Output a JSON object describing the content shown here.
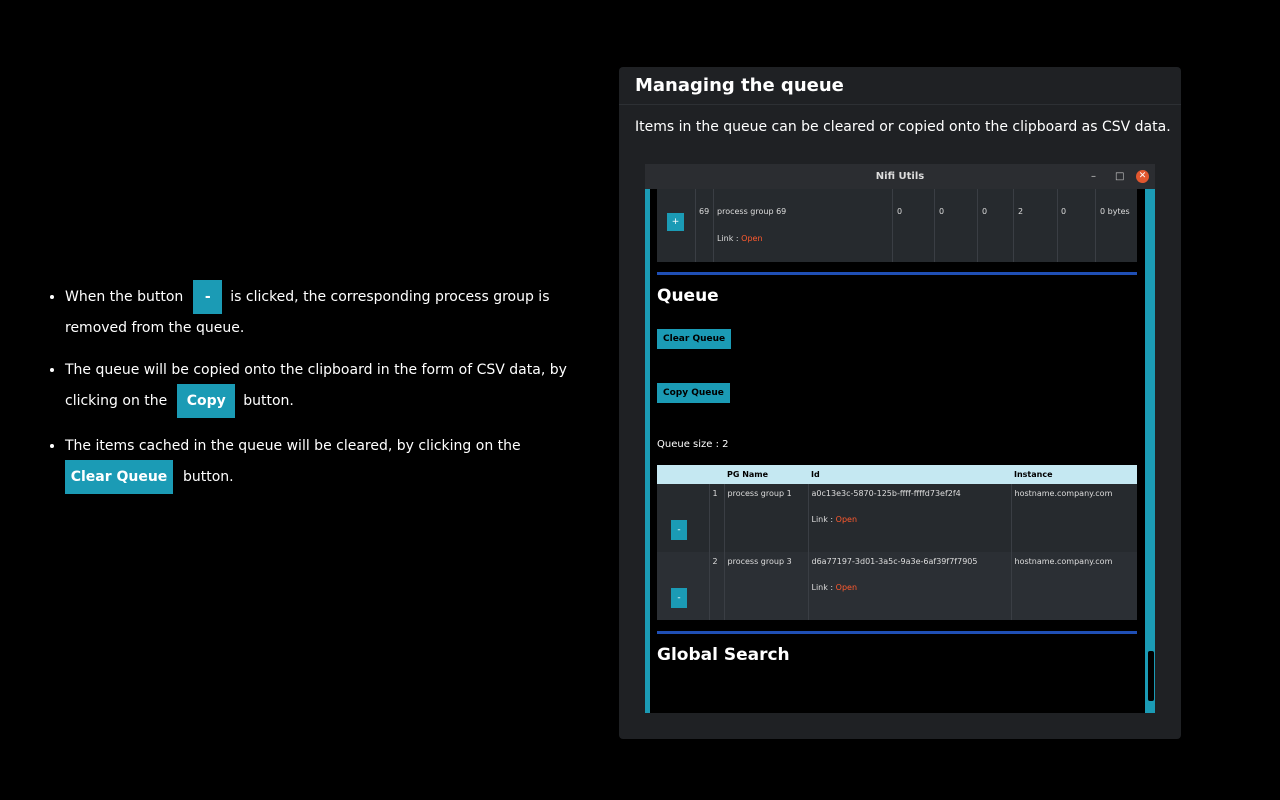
{
  "bullets": {
    "b1_before": "When the button",
    "b1_btn": "-",
    "b1_after": "is clicked, the corresponding process group is removed from the queue.",
    "b2_before": "The queue will be copied onto the clipboard in the form of CSV data, by clicking on the",
    "b2_btn": "Copy",
    "b2_after": "button.",
    "b3_before": "The items cached in the queue will be cleared, by clicking on the",
    "b3_btn": "Clear Queue",
    "b3_after": "button."
  },
  "card": {
    "title": "Managing the queue",
    "description": "Items in the queue can be cleared or copied onto the clipboard as CSV data."
  },
  "window": {
    "title": "Nifi Utils",
    "minimize": "–",
    "maximize": "□",
    "close": "✕"
  },
  "pg_row": {
    "plus": "+",
    "id": "69",
    "name": "process group 69",
    "c1": "0",
    "c2": "0",
    "c3": "0",
    "c4": "2",
    "c5": "0",
    "size": "0 bytes",
    "link_label": "Link :",
    "link_text": "Open"
  },
  "queue": {
    "heading": "Queue",
    "clear_btn": "Clear Queue",
    "copy_btn": "Copy Queue",
    "size_label": "Queue size : 2",
    "columns": [
      "",
      "",
      "PG Name",
      "Id",
      "Instance"
    ],
    "rows": [
      {
        "num": "1",
        "name": "process group 1",
        "id": "a0c13e3c-5870-125b-ffff-ffffd73ef2f4",
        "instance": "hostname.company.com",
        "link_label": "Link :",
        "link_text": "Open",
        "btn": "-"
      },
      {
        "num": "2",
        "name": "process group 3",
        "id": "d6a77197-3d01-3a5c-9a3e-6af39f7f7905",
        "instance": "hostname.company.com",
        "link_label": "Link :",
        "link_text": "Open",
        "btn": "-"
      }
    ]
  },
  "global_search": {
    "heading": "Global Search"
  },
  "colors": {
    "accent": "#1b9bb5",
    "divider": "#1f4fb5",
    "link": "#ff5a2e",
    "table_header": "#c5e8f2",
    "close_button": "#e2572f"
  }
}
